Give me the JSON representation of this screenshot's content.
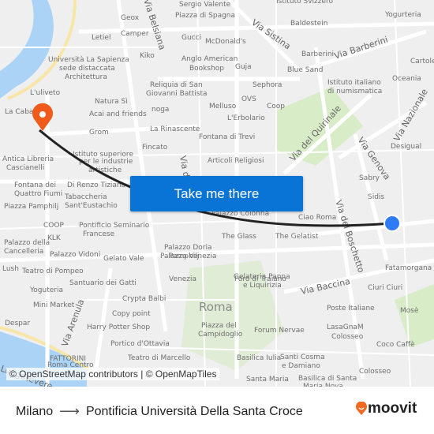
{
  "map": {
    "labels": [
      "Sergio Valente",
      "Piazza di Spagna",
      "Istituto Svizzero",
      "Yogurteria",
      "Geox",
      "Camper",
      "Letiel",
      "Gucci",
      "McDonald's",
      "Baldestein",
      "Kiko",
      "Anglo American",
      "Bookshop",
      "Guja",
      "Barberini",
      "Blue Sand",
      "Cartoleria",
      "Università La Sapienza",
      "sede distaccata",
      "Architettura",
      "Oceania",
      "L'uliveto",
      "Reliquia di San",
      "Giovanni Battista",
      "Sephora",
      "Istituto italiano",
      "di numismatica",
      "Natura Sì",
      "OVS",
      "Coop",
      "Acai and friends",
      "noga",
      "Melluso",
      "L'Erbolario",
      "La Cabala",
      "Grom",
      "La Rinascente",
      "Fontana di Trevi",
      "Desigual",
      "Fincato",
      "Antica Libreria",
      "Cascianelli",
      "Istituto superiore",
      "per le industrie",
      "artistiche",
      "Articoli Religiosi",
      "Sabry",
      "Fontana dei",
      "Quattro Fiumi",
      "Di Renzo Tiziana",
      "Tabaccheria",
      "Sant'Eustachio",
      "Sidis",
      "Piazza Pamphilj",
      "Palazzo Colonna",
      "Ciao Roma",
      "COOP",
      "KLK",
      "Pontificio Seminario",
      "Francese",
      "Palazzo della",
      "Cancelleria",
      "Palazzo Doria",
      "Pamphilj",
      "The Glass",
      "The Gelatist",
      "Palazzo Vidoni",
      "Gelato Vale",
      "Palazzo Venezia",
      "Gelateria Panna",
      "e Liquirizia",
      "Fatamorgana",
      "Lush",
      "Teatro di Pompeo",
      "Santuario dei Gatti",
      "Venezia",
      "Foro di Traiano",
      "Ciuri Ciuri",
      "Yoguteria",
      "Mini Market",
      "Crypta Balbi",
      "Poste Italiane",
      "Mosè",
      "Despar",
      "Copy point",
      "Harry Potter Shop",
      "Piazza del",
      "Campidoglio",
      "Forum Nervae",
      "LasaGnaM",
      "Colosseo",
      "Portico d'Ottavia",
      "Coco Caffè",
      "FATTORINI",
      "Teatro di Marcello",
      "Basilica Iulia",
      "Santi Cosma",
      "e Damiano",
      "Roma Centro",
      "Colosseo",
      "Santa Maria",
      "Basilica di Santa",
      "Maria Nova"
    ],
    "streets": [
      "Via Sistina",
      "Via Barberini",
      "Via del Quirinale",
      "Via Genova",
      "Via Nazionale",
      "Via del Boschetto",
      "Via Baccina",
      "Via Arenula",
      "Via Belsiana",
      "Via del Corso",
      "Lungotevere"
    ],
    "district": "Roma",
    "origin_pin_color": "#f05a1a",
    "destination_dot_color": "#2f7bf5",
    "route_color": "#222222"
  },
  "cta": {
    "label": "Take me there",
    "color": "#0a74d6"
  },
  "attribution": "© OpenStreetMap contributors | © OpenMapTiles",
  "footer": {
    "origin": "Milano",
    "arrow": "⟶",
    "destination": "Pontificia Università Della Santa Croce",
    "brand": "moovit",
    "brand_color": "#f26a21"
  }
}
